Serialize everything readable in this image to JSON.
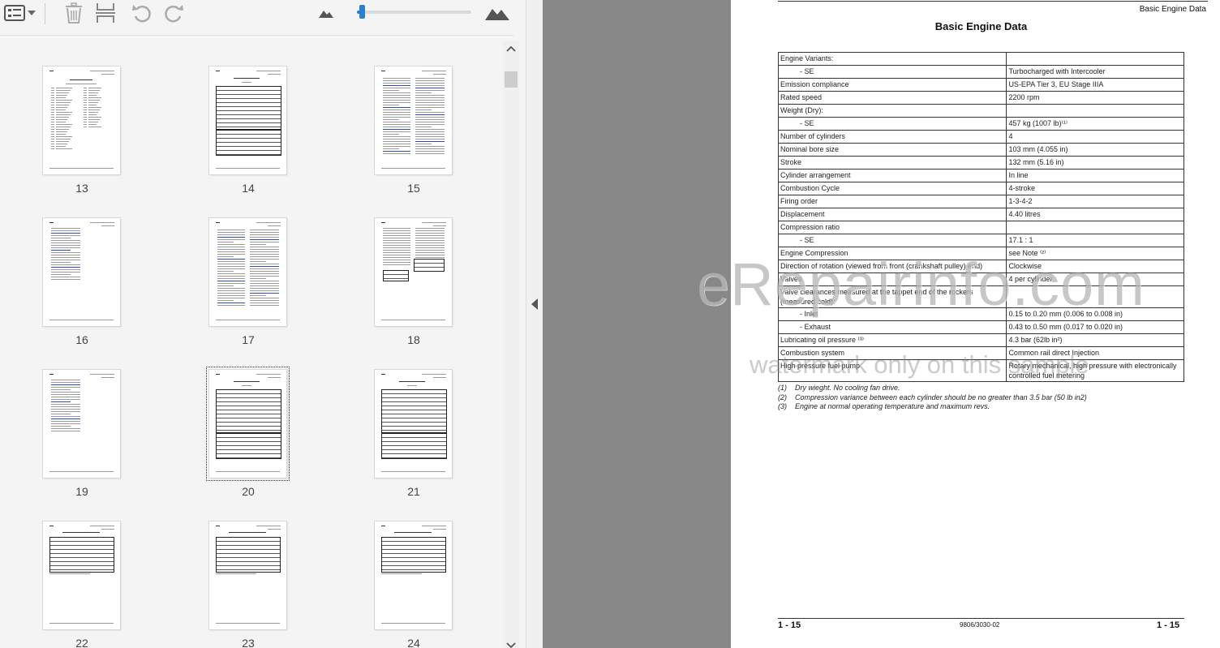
{
  "toolbar": {
    "icons": [
      "thumbnail-view-icon",
      "dropdown-caret-icon",
      "delete-icon",
      "page-layout-icon",
      "rotate-left-icon",
      "rotate-right-icon",
      "zoom-out-icon",
      "zoom-in-icon"
    ],
    "zoom_level": 0.02,
    "accent": "#2a7fd4"
  },
  "thumbnails": [
    {
      "page": "13",
      "layout": "index"
    },
    {
      "page": "14",
      "layout": "table"
    },
    {
      "page": "15",
      "layout": "twocol"
    },
    {
      "page": "16",
      "layout": "text"
    },
    {
      "page": "17",
      "layout": "twocol"
    },
    {
      "page": "18",
      "layout": "twocol-table"
    },
    {
      "page": "19",
      "layout": "text"
    },
    {
      "page": "20",
      "layout": "table",
      "selected": true
    },
    {
      "page": "21",
      "layout": "table"
    },
    {
      "page": "22",
      "layout": "smalltable"
    },
    {
      "page": "23",
      "layout": "smalltable"
    },
    {
      "page": "24",
      "layout": "smalltable"
    }
  ],
  "document": {
    "header_right": "Basic Engine Data",
    "title": "Basic Engine Data",
    "rows": [
      {
        "k": "Engine Variants:",
        "v": "",
        "indent": false
      },
      {
        "k": "- SE",
        "v": "Turbocharged with Intercooler",
        "indent": true
      },
      {
        "k": "Emission compliance",
        "v": "US-EPA Tier 3, EU Stage IIIA",
        "indent": false
      },
      {
        "k": "Rated speed",
        "v": "2200 rpm",
        "indent": false
      },
      {
        "k": "Weight (Dry):",
        "v": "",
        "indent": false
      },
      {
        "k": "- SE",
        "v": "457 kg (1007 lb)⁽¹⁾",
        "indent": true
      },
      {
        "k": "Number of cylinders",
        "v": "4",
        "indent": false
      },
      {
        "k": "Nominal bore size",
        "v": "103 mm (4.055 in)",
        "indent": false
      },
      {
        "k": "Stroke",
        "v": "132 mm (5.16 in)",
        "indent": false
      },
      {
        "k": "Cylinder arrangement",
        "v": "In line",
        "indent": false
      },
      {
        "k": "Combustion Cycle",
        "v": "4-stroke",
        "indent": false
      },
      {
        "k": "Firing order",
        "v": "1-3-4-2",
        "indent": false
      },
      {
        "k": "Displacement",
        "v": "4.40 litres",
        "indent": false
      },
      {
        "k": "Compression ratio",
        "v": "",
        "indent": false
      },
      {
        "k": "- SE",
        "v": "17.1 : 1",
        "indent": true
      },
      {
        "k": "Engine Compression",
        "v": "see Note ⁽²⁾",
        "indent": false
      },
      {
        "k": "Direction of rotation (viewed from front (crankshaft pulley) end)",
        "v": "Clockwise",
        "indent": false
      },
      {
        "k": "Valves",
        "v": "4 per cylinder",
        "indent": false
      },
      {
        "k": "Valve clearances measured at the tappet end of the rockers (measured cold):",
        "v": "",
        "indent": false
      },
      {
        "k": "- Inlet",
        "v": "0.15 to 0.20 mm (0.006 to 0.008 in)",
        "indent": true
      },
      {
        "k": "- Exhaust",
        "v": "0.43 to 0.50 mm (0.017 to 0.020 in)",
        "indent": true
      },
      {
        "k": "Lubricating oil pressure ⁽³⁾",
        "v": "4.3 bar (62lb in²)",
        "indent": false
      },
      {
        "k": "Combustion system",
        "v": "Common rail direct Injection",
        "indent": false
      },
      {
        "k": "High pressure fuel pump",
        "v": "Rotary mechanical, high pressure with electronically controlled fuel metering",
        "indent": false
      }
    ],
    "notes": [
      {
        "num": "(1)",
        "text": "Dry wieght. No cooling fan drive."
      },
      {
        "num": "(2)",
        "text": "Compression variance between each cylinder should be no greater than 3.5 bar (50 lb in2)"
      },
      {
        "num": "(3)",
        "text": "Engine at normal operating temperature and maximum revs."
      }
    ],
    "footer_left": "1 - 15",
    "footer_center": "9806/3030-02",
    "footer_right": "1 - 15"
  },
  "watermark": {
    "line1": "eRepairinfo.com",
    "line2": "watermark only on this sample"
  }
}
